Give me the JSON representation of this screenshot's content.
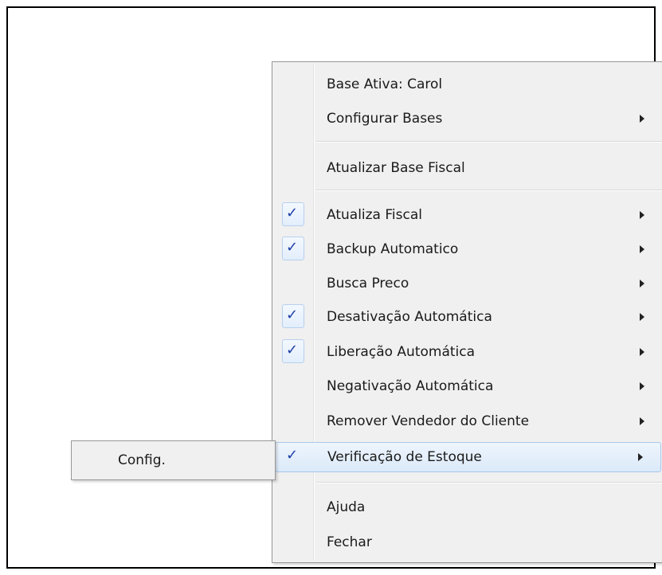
{
  "menu": {
    "items": [
      {
        "label": "Base Ativa: Carol"
      },
      {
        "label": "Configurar Bases"
      },
      {
        "label": "Atualizar Base Fiscal"
      },
      {
        "label": "Atualiza Fiscal"
      },
      {
        "label": "Backup Automatico"
      },
      {
        "label": "Busca Preco"
      },
      {
        "label": "Desativação Automática"
      },
      {
        "label": "Liberação Automática"
      },
      {
        "label": "Negativação Automática"
      },
      {
        "label": "Remover Vendedor do Cliente"
      },
      {
        "label": "Verificação de Estoque"
      },
      {
        "label": "Ajuda"
      },
      {
        "label": "Fechar"
      }
    ],
    "check_glyph": "✓"
  },
  "submenu": {
    "items": [
      {
        "label": "Config."
      }
    ]
  },
  "colors": {
    "menu_background": "#f0f0f0",
    "highlight": "#dbe9f9",
    "check": "#1d3fa8"
  }
}
